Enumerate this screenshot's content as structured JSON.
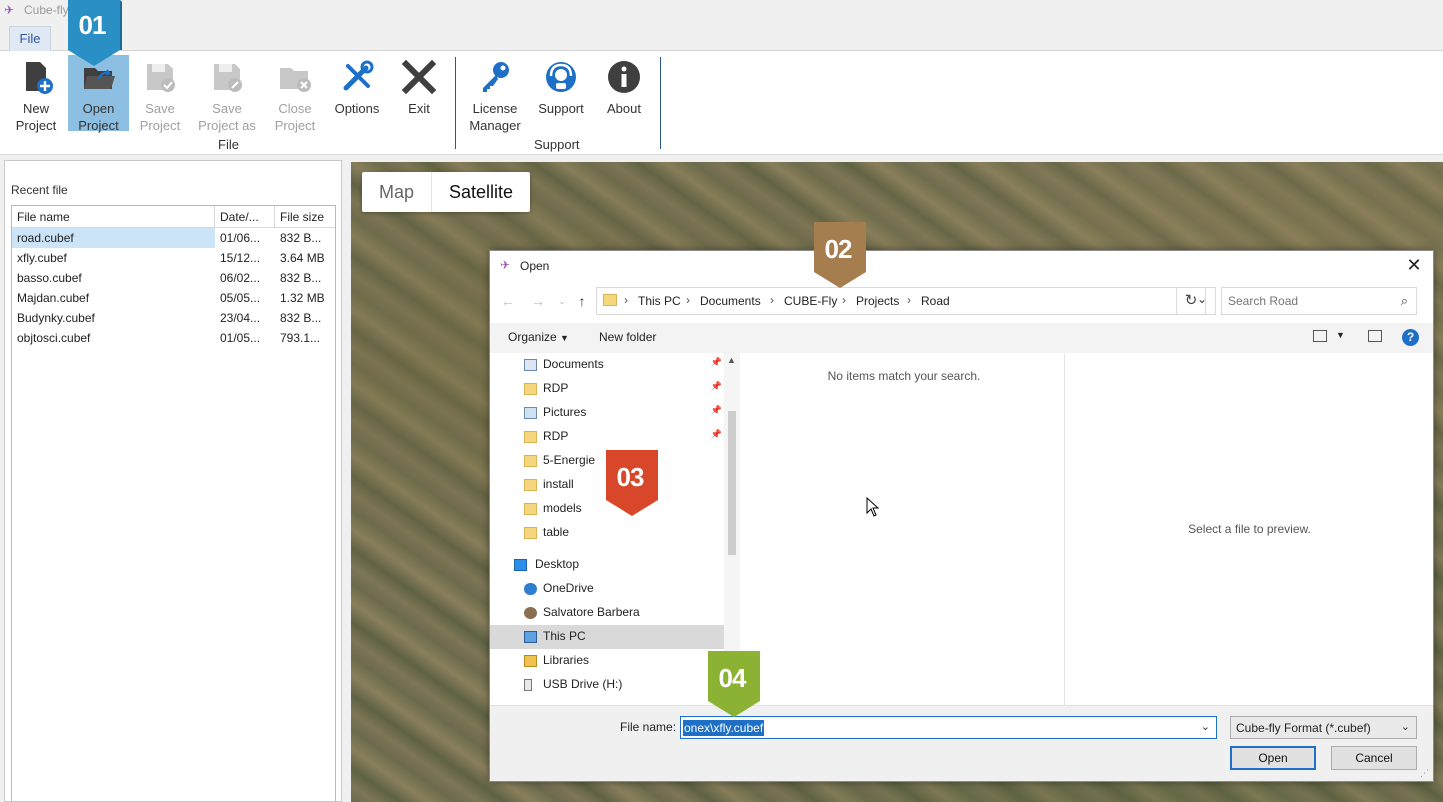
{
  "window": {
    "title": "Cube-fly"
  },
  "ribbon": {
    "tab_file": "File",
    "buttons": {
      "new_project": [
        "New",
        "Project"
      ],
      "open_project": [
        "Open",
        "Project"
      ],
      "save_project": [
        "Save",
        "Project"
      ],
      "save_project_as": [
        "Save",
        "Project as"
      ],
      "close_project": [
        "Close",
        "Project"
      ],
      "options": [
        "Options"
      ],
      "exit": [
        "Exit"
      ],
      "license_manager": [
        "License",
        "Manager"
      ],
      "support": [
        "Support"
      ],
      "about": [
        "About"
      ]
    },
    "groups": {
      "file": "File",
      "support": "Support"
    },
    "accent_color": "#2b5797",
    "active_button_color": "#8dbfe3"
  },
  "recent_files": {
    "label": "Recent file",
    "columns": [
      "File name",
      "Date/...",
      "File size"
    ],
    "rows": [
      [
        "road.cubef",
        "01/06...",
        "832 B..."
      ],
      [
        "xfly.cubef",
        "15/12...",
        "3.64 MB"
      ],
      [
        "basso.cubef",
        "06/02...",
        "832 B..."
      ],
      [
        "Majdan.cubef",
        "05/05...",
        "1.32 MB"
      ],
      [
        "Budynky.cubef",
        "23/04...",
        "832 B..."
      ],
      [
        "objtosci.cubef",
        "01/05...",
        "793.1..."
      ]
    ],
    "selected_index": 0
  },
  "map": {
    "toggle": {
      "map": "Map",
      "satellite": "Satellite"
    },
    "selected": "Satellite"
  },
  "dialog": {
    "title": "Open",
    "address": [
      "This PC",
      "Documents",
      "CUBE-Fly",
      "Projects",
      "Road"
    ],
    "search_placeholder": "Search Road",
    "commands": {
      "organize": "Organize",
      "new_folder": "New folder"
    },
    "nav_items": [
      {
        "label": "Documents",
        "icon": "documents-icon",
        "pinned": true
      },
      {
        "label": "RDP",
        "icon": "folder-icon",
        "pinned": true
      },
      {
        "label": "Pictures",
        "icon": "pictures-icon",
        "pinned": true
      },
      {
        "label": "RDP",
        "icon": "folder-icon",
        "pinned": true
      },
      {
        "label": "5-Energie",
        "icon": "folder-icon",
        "pinned": false
      },
      {
        "label": "install",
        "icon": "folder-icon",
        "pinned": false
      },
      {
        "label": "models",
        "icon": "folder-icon",
        "pinned": false
      },
      {
        "label": "table",
        "icon": "folder-icon",
        "pinned": false
      },
      {
        "label": "Desktop",
        "icon": "desktop-icon",
        "pinned": false
      },
      {
        "label": "OneDrive",
        "icon": "cloud-icon",
        "pinned": false
      },
      {
        "label": "Salvatore Barbera",
        "icon": "user-icon",
        "pinned": false
      },
      {
        "label": "This PC",
        "icon": "computer-icon",
        "pinned": false
      },
      {
        "label": "Libraries",
        "icon": "libraries-icon",
        "pinned": false
      },
      {
        "label": "USB Drive (H:)",
        "icon": "usb-drive-icon",
        "pinned": false
      }
    ],
    "selected_nav": "This PC",
    "empty_message": "No items match your search.",
    "preview_message": "Select a file to preview.",
    "file_name_label": "File name:",
    "file_name_value": "onex\\xfly.cubef",
    "filter": "Cube-fly Format (*.cubef)",
    "open_button": "Open",
    "cancel_button": "Cancel"
  },
  "badges": [
    {
      "label": "01",
      "color": "#2a8fc5"
    },
    {
      "label": "02",
      "color": "#a57d4f"
    },
    {
      "label": "03",
      "color": "#d9472b"
    },
    {
      "label": "04",
      "color": "#8bb233"
    }
  ]
}
